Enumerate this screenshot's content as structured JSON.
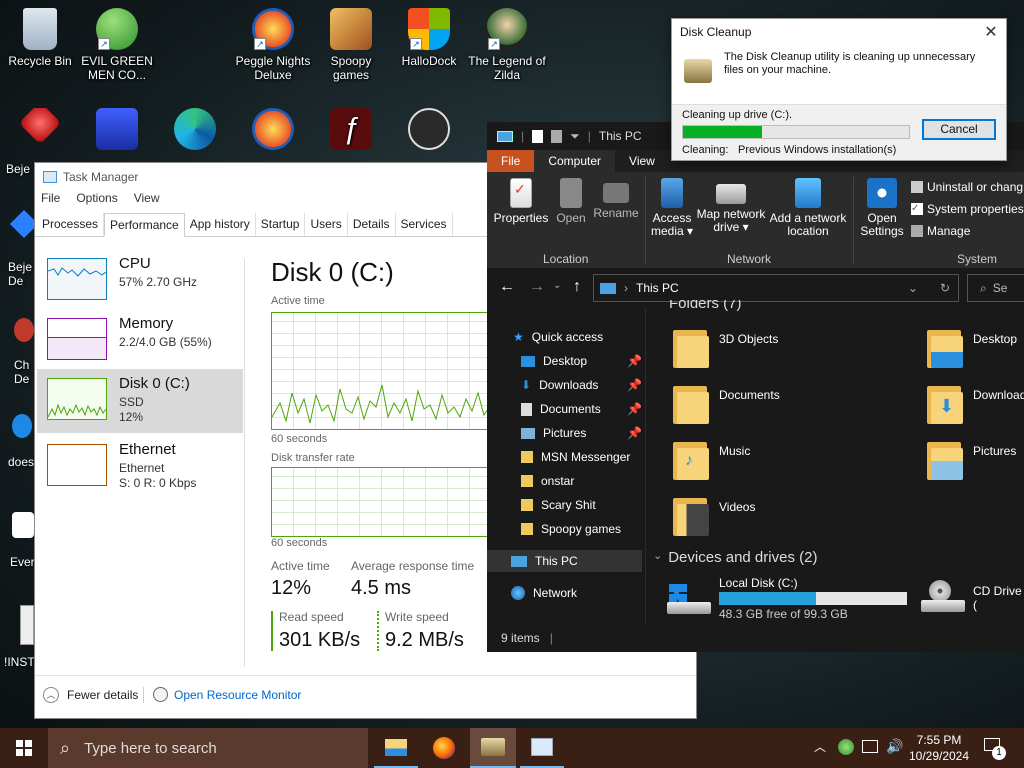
{
  "desktop": {
    "icons": [
      {
        "label": "Recycle Bin",
        "icon": "recycle-bin-icon",
        "color": "#c8d4e0"
      },
      {
        "label": "EVIL GREEN MEN CO...",
        "icon": "msn-icon",
        "color": "#3cae3c"
      },
      {
        "label": "Peggle Nights Deluxe",
        "icon": "peggle-icon",
        "color": "#e8542a"
      },
      {
        "label": "Spoopy games",
        "icon": "folder-icon",
        "color": "#d9a441"
      },
      {
        "label": "HalloDock",
        "icon": "windows-logo-icon",
        "color": "#f25022"
      },
      {
        "label": "The Legend of Zilda",
        "icon": "zilda-icon",
        "color": "#3a6f3a"
      }
    ],
    "row2_partial": [
      {
        "label": "Beje De",
        "icon": "bejeweled-icon"
      },
      {
        "label": "",
        "icon": "mpl-icon"
      },
      {
        "label": "",
        "icon": "edge-icon"
      },
      {
        "label": "",
        "icon": "peggle-icon"
      },
      {
        "label": "",
        "icon": "flash-icon"
      },
      {
        "label": "",
        "icon": "rdp-icon"
      }
    ],
    "left_partial": [
      {
        "label": "Beje De"
      },
      {
        "label": "Ch De"
      },
      {
        "label": "does"
      },
      {
        "label": "Ever"
      },
      {
        "label": "!INSTA"
      }
    ]
  },
  "task_manager": {
    "title": "Task Manager",
    "menu": [
      "File",
      "Options",
      "View"
    ],
    "tabs": [
      "Processes",
      "Performance",
      "App history",
      "Startup",
      "Users",
      "Details",
      "Services"
    ],
    "active_tab": "Performance",
    "sidebar": [
      {
        "name": "CPU",
        "sub1": "57%  2.70 GHz",
        "sub2": "",
        "sub3": "",
        "color": "#117dbb"
      },
      {
        "name": "Memory",
        "sub1": "2.2/4.0 GB (55%)",
        "sub2": "",
        "sub3": "",
        "color": "#8b12ae"
      },
      {
        "name": "Disk 0 (C:)",
        "sub1": "SSD",
        "sub2": "12%",
        "sub3": "",
        "color": "#4da60c"
      },
      {
        "name": "Ethernet",
        "sub1": "Ethernet",
        "sub2": "S: 0  R: 0 Kbps",
        "sub3": "",
        "color": "#a74f01"
      }
    ],
    "main": {
      "title": "Disk 0 (C:)",
      "graph1_label": "Active time",
      "graph1_axis": "60 seconds",
      "graph2_label": "Disk transfer rate",
      "graph2_axis": "60 seconds",
      "active_time_label": "Active time",
      "active_time_value": "12%",
      "avg_resp_label": "Average response time",
      "avg_resp_value": "4.5 ms",
      "read_label": "Read speed",
      "read_value": "301 KB/s",
      "write_label": "Write speed",
      "write_value": "9.2 MB/s"
    },
    "footer": {
      "fewer": "Fewer details",
      "resmon": "Open Resource Monitor"
    }
  },
  "explorer": {
    "title": "This PC",
    "ribbon_tabs": [
      "File",
      "Computer",
      "View"
    ],
    "buttons": {
      "properties": "Properties",
      "open": "Open",
      "rename": "Rename",
      "access_media": "Access media",
      "map_drive": "Map network drive",
      "add_location": "Add a network location",
      "open_settings": "Open Settings",
      "uninstall": "Uninstall or chang",
      "sysprops": "System properties",
      "manage": "Manage"
    },
    "groups": {
      "location": "Location",
      "network": "Network",
      "system": "System"
    },
    "address": "This PC",
    "search_placeholder": "Se",
    "nav": [
      {
        "label": "Quick access",
        "pin": false
      },
      {
        "label": "Desktop",
        "pin": true
      },
      {
        "label": "Downloads",
        "pin": true
      },
      {
        "label": "Documents",
        "pin": true
      },
      {
        "label": "Pictures",
        "pin": true
      },
      {
        "label": "MSN Messenger",
        "pin": false
      },
      {
        "label": "onstar",
        "pin": false
      },
      {
        "label": "Scary Shit",
        "pin": false
      },
      {
        "label": "Spoopy games",
        "pin": false
      },
      {
        "label": "This PC",
        "pin": false
      },
      {
        "label": "Network",
        "pin": false
      }
    ],
    "folders_header": "Folders (7)",
    "folders": [
      "3D Objects",
      "Desktop",
      "Documents",
      "Downloads",
      "Music",
      "Pictures",
      "Videos"
    ],
    "devices_header": "Devices and drives (2)",
    "drive_c": {
      "name": "Local Disk (C:)",
      "free": "48.3 GB free of 99.3 GB",
      "used_fraction": 0.514
    },
    "drive_d": {
      "name": "CD Drive ("
    },
    "status": "9 items"
  },
  "disk_cleanup": {
    "title": "Disk Cleanup",
    "message": "The Disk Cleanup utility is cleaning up unnecessary files on your machine.",
    "progress_label": "Cleaning up drive  (C:).",
    "progress_fraction": 0.35,
    "cancel": "Cancel",
    "cleaning_label": "Cleaning:",
    "cleaning_value": "Previous Windows installation(s)"
  },
  "taskbar": {
    "search_placeholder": "Type here to search",
    "time": "7:55 PM",
    "date": "10/29/2024",
    "notification_count": "1"
  }
}
